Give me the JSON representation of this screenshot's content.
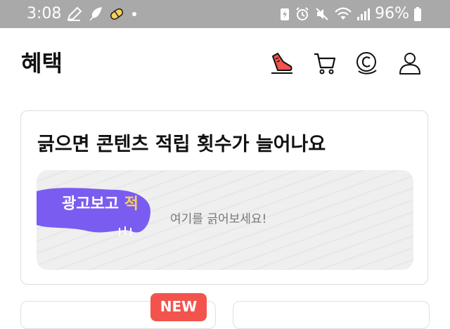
{
  "status_bar": {
    "time": "3:08",
    "battery_percent": "96%",
    "left_icons": [
      "pencil-icon",
      "feather-icon",
      "pill-icon",
      "dot-icon"
    ],
    "right_icons": [
      "battery-saver-icon",
      "alarm-icon",
      "mute-icon",
      "wifi-icon",
      "signal-icon",
      "battery-icon"
    ]
  },
  "header": {
    "title": "혜택",
    "icons": [
      "shoe-icon",
      "cart-icon",
      "coin-icon",
      "profile-icon"
    ]
  },
  "scratch_card": {
    "title": "긁으면 콘텐츠 적립 횟수가 늘어나요",
    "ad_label": "광고보고",
    "ad_label_extra": "적",
    "hint": "여기를 긁어보세요!"
  },
  "bottom": {
    "badge": "NEW"
  },
  "colors": {
    "status_bar_bg": "#a9a9a9",
    "scratch_blob": "#7b5cf0",
    "badge_red": "#f2544d",
    "shoe_red": "#f2544d"
  }
}
